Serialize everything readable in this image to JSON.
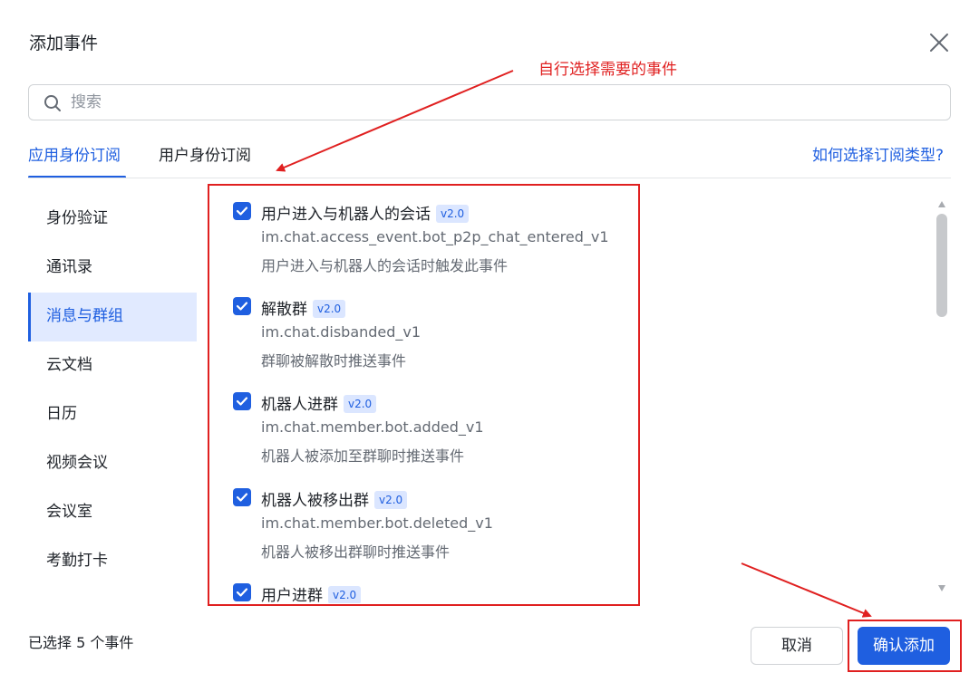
{
  "dialog": {
    "title": "添加事件"
  },
  "search": {
    "placeholder": "搜索"
  },
  "tabs": [
    {
      "label": "应用身份订阅",
      "active": true
    },
    {
      "label": "用户身份订阅",
      "active": false
    }
  ],
  "help_link": "如何选择订阅类型?",
  "sidebar": {
    "items": [
      {
        "label": "身份验证"
      },
      {
        "label": "通讯录"
      },
      {
        "label": "消息与群组",
        "active": true
      },
      {
        "label": "云文档"
      },
      {
        "label": "日历"
      },
      {
        "label": "视频会议"
      },
      {
        "label": "会议室"
      },
      {
        "label": "考勤打卡"
      }
    ]
  },
  "events": [
    {
      "name": "用户进入与机器人的会话",
      "version": "v2.0",
      "code": "im.chat.access_event.bot_p2p_chat_entered_v1",
      "desc": "用户进入与机器人的会话时触发此事件",
      "checked": true
    },
    {
      "name": "解散群",
      "version": "v2.0",
      "code": "im.chat.disbanded_v1",
      "desc": "群聊被解散时推送事件",
      "checked": true
    },
    {
      "name": "机器人进群",
      "version": "v2.0",
      "code": "im.chat.member.bot.added_v1",
      "desc": "机器人被添加至群聊时推送事件",
      "checked": true
    },
    {
      "name": "机器人被移出群",
      "version": "v2.0",
      "code": "im.chat.member.bot.deleted_v1",
      "desc": "机器人被移出群聊时推送事件",
      "checked": true
    },
    {
      "name": "用户进群",
      "version": "v2.0",
      "code": "",
      "desc": "",
      "checked": true
    }
  ],
  "footer": {
    "selected_count": "已选择 5 个事件",
    "cancel_label": "取消",
    "confirm_label": "确认添加"
  },
  "annotation": {
    "text": "自行选择需要的事件",
    "color": "#e02020"
  },
  "colors": {
    "accent": "#1f5fe0",
    "annotation": "#e02020"
  }
}
